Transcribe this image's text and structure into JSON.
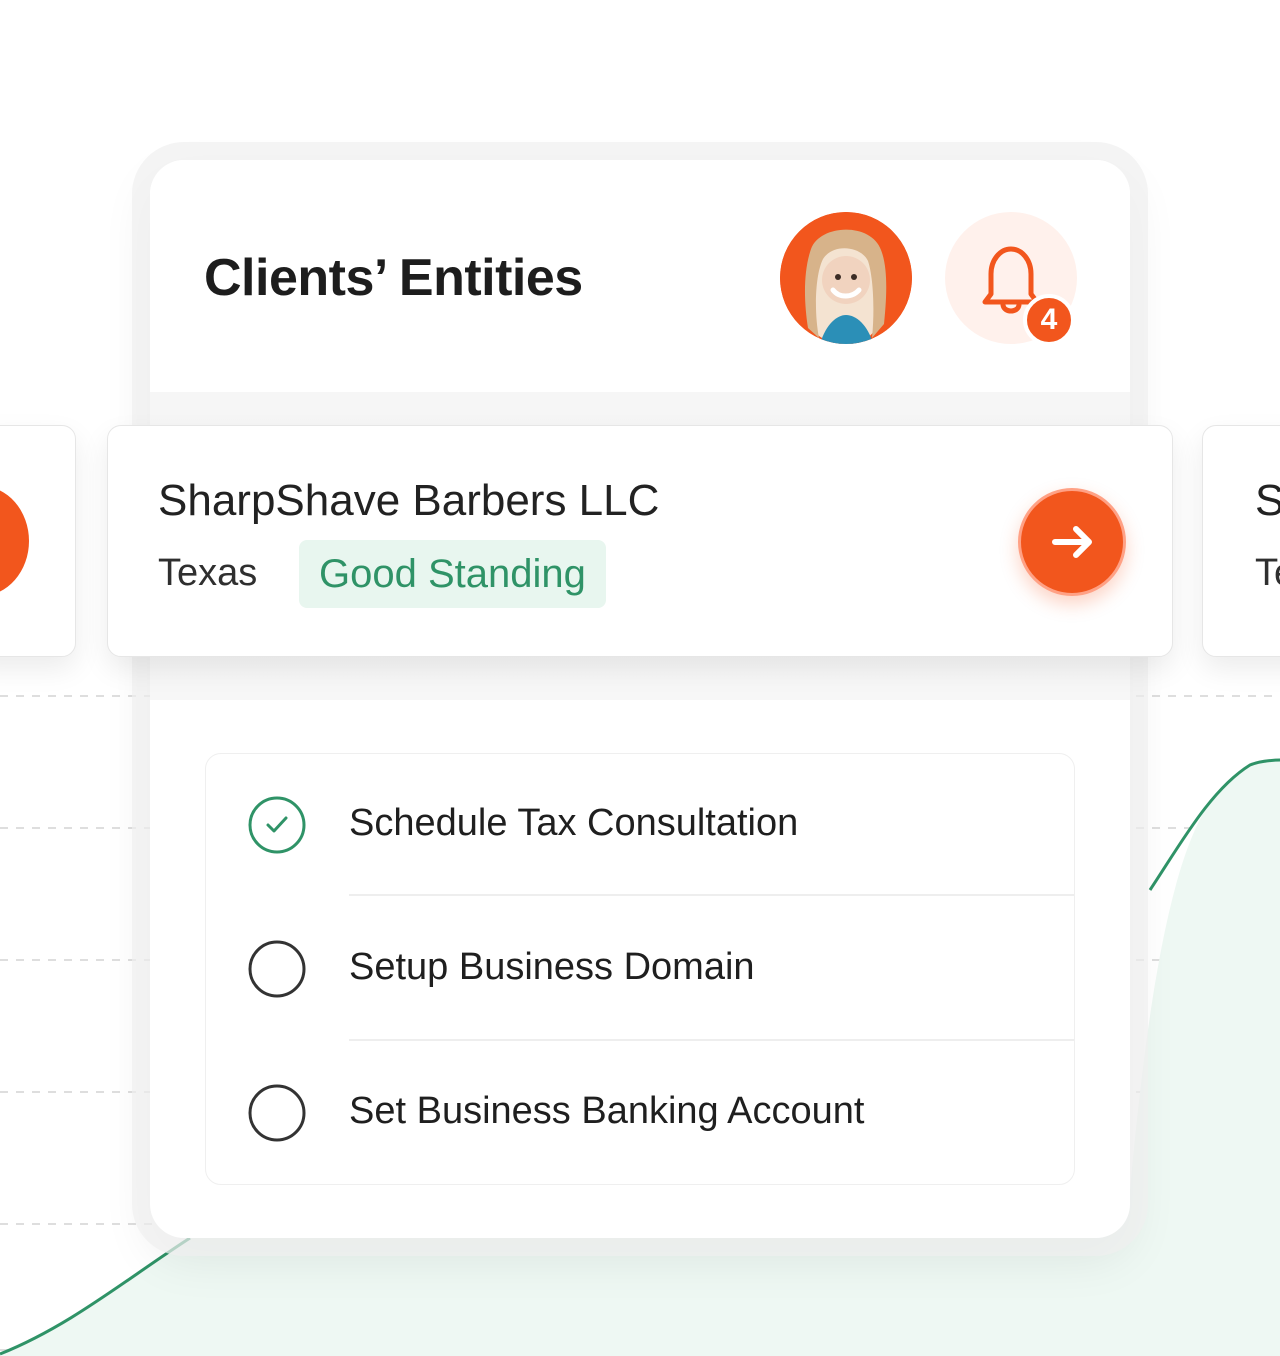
{
  "header": {
    "title": "Clients’ Entities",
    "notification_count": "4"
  },
  "entity": {
    "name": "SharpShave Barbers LLC",
    "state": "Texas",
    "status": "Good Standing"
  },
  "peek_right": {
    "name_letter": "S",
    "state_letter": "Te"
  },
  "tasks": [
    {
      "label": "Schedule Tax Consultation",
      "done": true
    },
    {
      "label": "Setup Business Domain",
      "done": false
    },
    {
      "label": "Set Business Banking Account",
      "done": false
    }
  ],
  "colors": {
    "accent": "#f2561d",
    "success": "#2f9367",
    "success_bg": "#e8f6ef",
    "chart_line": "#2f9367",
    "chart_fill": "#eaf6f0"
  },
  "icons": {
    "avatar": "avatar",
    "bell": "bell-icon",
    "arrow": "arrow-right-icon",
    "check": "check-circle-icon",
    "empty": "empty-circle-icon"
  }
}
